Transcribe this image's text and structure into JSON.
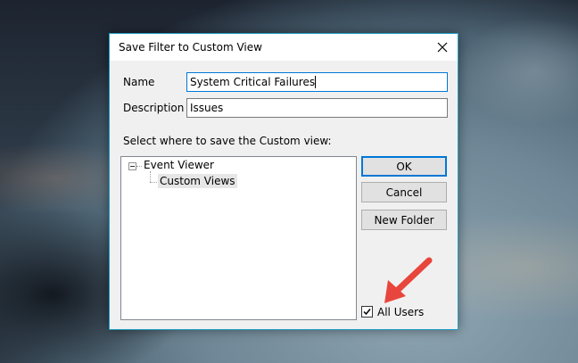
{
  "dialog": {
    "title": "Save Filter to Custom View",
    "name_label": "Name",
    "name_value": "System Critical Failures",
    "description_label": "Description",
    "description_value": "Issues",
    "location_label": "Select where to save the Custom view:",
    "tree": {
      "root": "Event Viewer",
      "child": "Custom Views"
    },
    "buttons": {
      "ok": "OK",
      "cancel": "Cancel",
      "new_folder": "New Folder"
    },
    "all_users_label": "All Users",
    "all_users_checked": true
  },
  "colors": {
    "accent_border": "#1e9ec6",
    "annotation_arrow": "#e8453c",
    "focus_blue": "#0078d7"
  },
  "icons": [
    "close-icon",
    "expander-minus-icon",
    "checkmark-icon",
    "annotation-arrow"
  ]
}
